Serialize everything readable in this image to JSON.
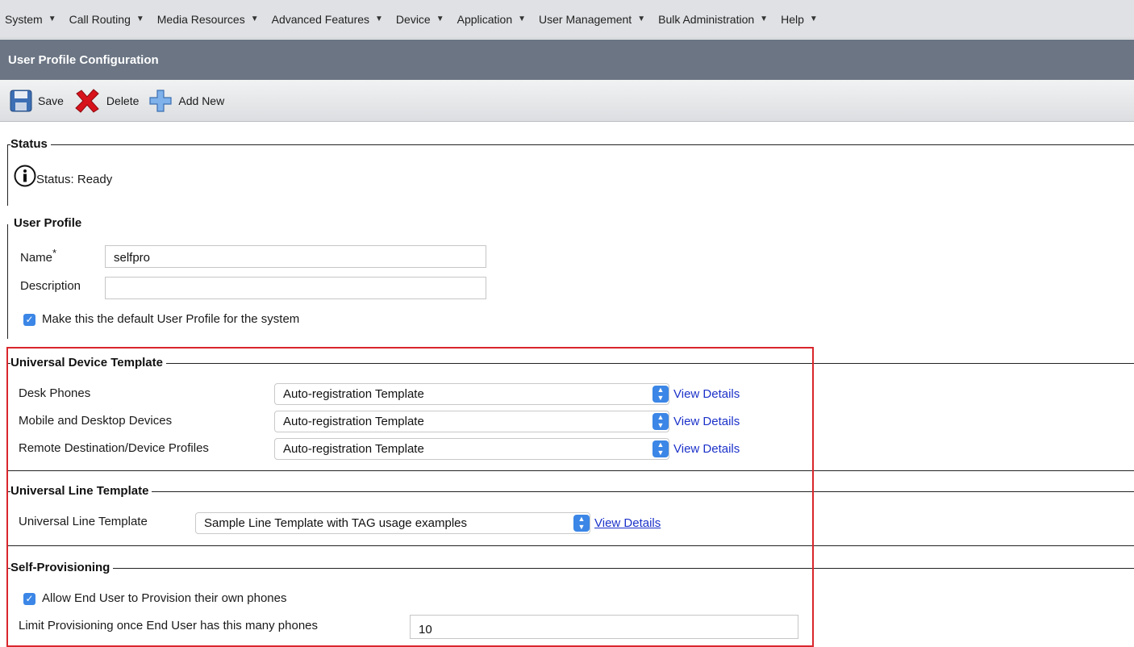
{
  "menu": [
    {
      "label": "System"
    },
    {
      "label": "Call Routing"
    },
    {
      "label": "Media Resources"
    },
    {
      "label": "Advanced Features"
    },
    {
      "label": "Device"
    },
    {
      "label": "Application"
    },
    {
      "label": "User Management"
    },
    {
      "label": "Bulk Administration"
    },
    {
      "label": "Help"
    }
  ],
  "title": "User Profile Configuration",
  "toolbar": {
    "save_label": "Save",
    "delete_label": "Delete",
    "add_new_label": "Add New"
  },
  "status": {
    "legend": "Status",
    "text": "Status: Ready"
  },
  "user_profile": {
    "legend": "User Profile",
    "name_label": "Name",
    "required_mark": "*",
    "name_value": "selfpro",
    "description_label": "Description",
    "description_value": "",
    "default_checkbox_label": "Make this the default User Profile for the system",
    "default_checked": true
  },
  "universal_device_template": {
    "legend": "Universal Device Template",
    "rows": [
      {
        "label": "Desk Phones",
        "value": "Auto-registration Template",
        "link": "View Details"
      },
      {
        "label": "Mobile and Desktop Devices",
        "value": "Auto-registration Template",
        "link": "View Details"
      },
      {
        "label": "Remote Destination/Device Profiles",
        "value": "Auto-registration Template",
        "link": "View Details"
      }
    ]
  },
  "universal_line_template": {
    "legend": "Universal Line Template",
    "label": "Universal Line Template",
    "value": "Sample Line Template with TAG usage examples",
    "link": "View Details"
  },
  "self_provisioning": {
    "legend": "Self-Provisioning",
    "allow_label": "Allow End User to Provision their own phones",
    "allow_checked": true,
    "limit_label": "Limit Provisioning once End User has this many phones",
    "limit_value": "10"
  },
  "colors": {
    "title_bar": "#6b7584",
    "link": "#1c32c9",
    "highlight": "#d9262c",
    "accent": "#3b86e6"
  }
}
